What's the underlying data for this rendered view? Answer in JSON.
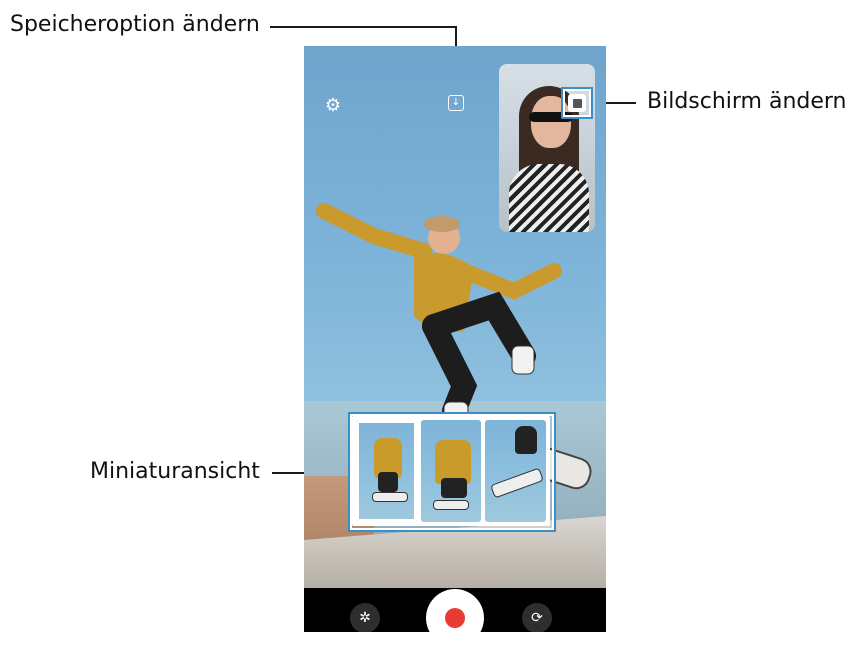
{
  "callouts": {
    "save_option": "Speicheroption ändern",
    "change_screen": "Bildschirm ändern",
    "thumbnail_view": "Miniaturansicht"
  },
  "icons": {
    "settings": "gear-icon",
    "save_option": "download-icon",
    "change_screen": "pip-swap-icon",
    "effects": "effects-icon",
    "record": "record-icon",
    "switch_camera": "camera-switch-icon"
  },
  "thumbnails": {
    "count": 3,
    "selected_index": 0
  },
  "colors": {
    "highlight": "#3b8fc9",
    "record": "#e63c32",
    "bar": "#000000"
  }
}
